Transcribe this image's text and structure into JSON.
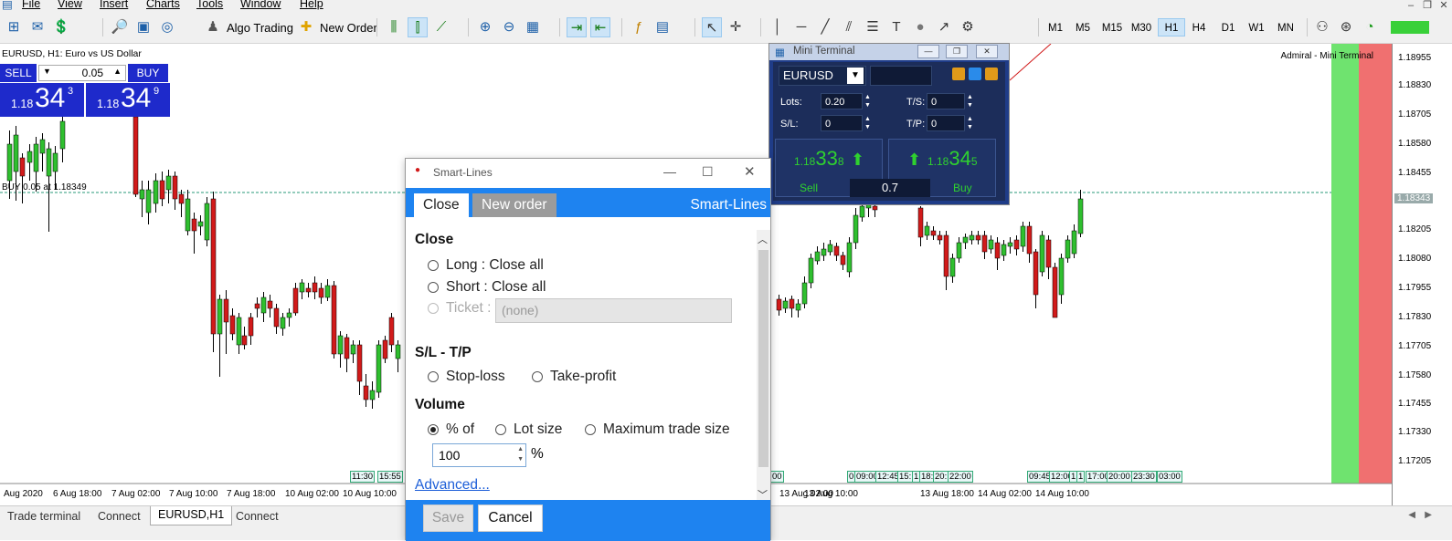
{
  "menu": [
    "File",
    "View",
    "Insert",
    "Charts",
    "Tools",
    "Window",
    "Help"
  ],
  "toolbar": {
    "algo_trading": "Algo Trading",
    "new_order": "New Order",
    "timeframes": [
      "M1",
      "M5",
      "M15",
      "M30",
      "H1",
      "H4",
      "D1",
      "W1",
      "MN"
    ],
    "active_timeframe": "H1"
  },
  "chart": {
    "title": "EURUSD, H1:  Euro vs US Dollar",
    "brand": "Admiral - Mini Terminal",
    "buy_label": "BUY 0.05 at 1.18349",
    "price_labels": [
      "1.18955",
      "1.18830",
      "1.18705",
      "1.18580",
      "1.18455",
      "1.18343",
      "1.18205",
      "1.18080",
      "1.17955",
      "1.17830",
      "1.17705",
      "1.17580",
      "1.17455",
      "1.17330",
      "1.17205"
    ],
    "time_labels": [
      "Aug 2020",
      "6 Aug 18:00",
      "7 Aug 02:00",
      "7 Aug 10:00",
      "7 Aug 18:00",
      "10 Aug 02:00",
      "10 Aug 10:00",
      "13 Aug 02:00",
      "13 Aug 10:00",
      "13 Aug 18:00",
      "14 Aug 02:00",
      "14 Aug 10:00"
    ],
    "bubbles": [
      "11:30",
      "15:55",
      "00",
      "0",
      "09:00",
      "12:45",
      "15:",
      "1",
      "18:",
      "20:",
      "22:00",
      "09:45",
      "12:00",
      "1",
      "1",
      "17:00",
      "20:00",
      "23:30",
      "03:00"
    ],
    "colors": {
      "bull": "#2fbf2f",
      "bear": "#d11a1a",
      "current": "#1e2acb"
    }
  },
  "one_click": {
    "sell": "SELL",
    "buy": "BUY",
    "lot": "0.05",
    "bid": {
      "prefix": "1.18",
      "big": "34",
      "sup": "3"
    },
    "ask": {
      "prefix": "1.18",
      "big": "34",
      "sup": "9"
    }
  },
  "mini_terminal": {
    "title": "Mini Terminal",
    "symbol": "EURUSD",
    "lots_label": "Lots:",
    "lots": "0.20",
    "sl_label": "S/L:",
    "sl": "0",
    "ts_label": "T/S:",
    "ts": "0",
    "tp_label": "T/P:",
    "tp": "0",
    "sell": {
      "prefix": "1.18",
      "big": "33",
      "sup": "8",
      "label": "Sell"
    },
    "buy": {
      "prefix": "1.18",
      "big": "34",
      "sup": "5",
      "label": "Buy"
    },
    "spread": "0.7"
  },
  "smart_lines": {
    "title": "Smart-Lines",
    "tabs": [
      "Close",
      "New order"
    ],
    "brand": "Smart-Lines",
    "close_heading": "Close",
    "long": "Long : Close all",
    "short": "Short : Close all",
    "ticket_label": "Ticket :",
    "ticket_value": "(none)",
    "sltp_heading": "S/L - T/P",
    "stop_loss": "Stop-loss",
    "take_profit": "Take-profit",
    "volume_heading": "Volume",
    "percent_of": "% of",
    "lot_size": "Lot size",
    "max_trade": "Maximum trade size",
    "volume_value": "100",
    "percent_sign": "%",
    "advanced": "Advanced...",
    "save": "Save",
    "cancel": "Cancel"
  },
  "bottom_tabs": [
    "Trade terminal",
    "Connect",
    "EURUSD,H1",
    "Connect"
  ]
}
